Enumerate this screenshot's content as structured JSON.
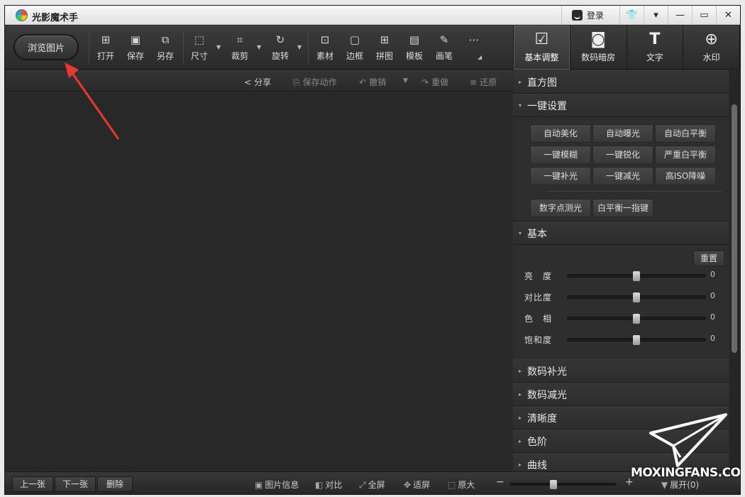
{
  "window": {
    "title": "光影魔术手",
    "login": "登录"
  },
  "toolbar": {
    "browse": "浏览图片",
    "tools": [
      {
        "label": "打开",
        "icon": "image-open-icon"
      },
      {
        "label": "保存",
        "icon": "save-icon"
      },
      {
        "label": "另存",
        "icon": "save-as-icon"
      },
      {
        "label": "尺寸",
        "icon": "resize-icon"
      },
      {
        "label": "裁剪",
        "icon": "crop-icon"
      },
      {
        "label": "旋转",
        "icon": "rotate-icon"
      },
      {
        "label": "素材",
        "icon": "sticker-icon"
      },
      {
        "label": "边框",
        "icon": "border-icon"
      },
      {
        "label": "拼图",
        "icon": "collage-icon"
      },
      {
        "label": "模板",
        "icon": "template-icon"
      },
      {
        "label": "画笔",
        "icon": "brush-icon"
      }
    ],
    "tabs": [
      {
        "label": "基本调整",
        "icon": "basic-adjust-icon"
      },
      {
        "label": "数码暗房",
        "icon": "darkroom-icon"
      },
      {
        "label": "文字",
        "icon": "text-icon"
      },
      {
        "label": "水印",
        "icon": "watermark-icon"
      }
    ]
  },
  "subbar": {
    "share": "分享",
    "save_action": "保存动作",
    "undo": "撤销",
    "redo": "重做",
    "restore": "还原"
  },
  "panel": {
    "histogram": "直方图",
    "one_click": {
      "title": "一键设置",
      "buttons": [
        "自动美化",
        "自动曝光",
        "自动白平衡",
        "一键模糊",
        "一键锐化",
        "严重白平衡",
        "一键补光",
        "一键减光",
        "高ISO降噪"
      ],
      "extra": [
        "数字点测光",
        "白平衡一指键"
      ]
    },
    "basic": {
      "title": "基本",
      "reset": "重置",
      "sliders": [
        {
          "label": "亮　度",
          "value": "0",
          "fraction": 0.5
        },
        {
          "label": "对比度",
          "value": "0",
          "fraction": 0.5
        },
        {
          "label": "色　相",
          "value": "0",
          "fraction": 0.5
        },
        {
          "label": "饱和度",
          "value": "0",
          "fraction": 0.5
        }
      ]
    },
    "sections": [
      "数码补光",
      "数码减光",
      "清晰度",
      "色阶",
      "曲线"
    ]
  },
  "bottom": {
    "prev": "上一张",
    "next": "下一张",
    "delete": "删除",
    "info": "图片信息",
    "compare": "对比",
    "fullscreen": "全屏",
    "fit": "适屏",
    "original": "原大",
    "expand": "展开(0)",
    "zoom_fraction": 0.4
  },
  "watermark": "MOXINGFANS.COM"
}
